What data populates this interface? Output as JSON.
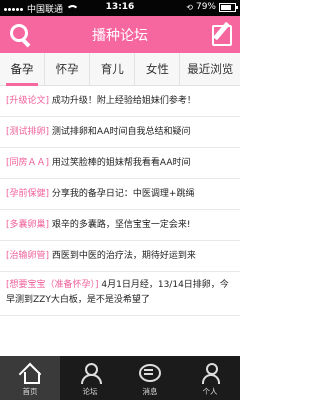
{
  "status": {
    "carrier": "中国联通",
    "time": "13:16",
    "battery": "79%"
  },
  "header": {
    "title": "播种论坛"
  },
  "tabs": [
    {
      "label": "备孕"
    },
    {
      "label": "怀孕"
    },
    {
      "label": "育儿"
    },
    {
      "label": "女性"
    },
    {
      "label": "最近浏览"
    }
  ],
  "posts": [
    {
      "tag": "[升级论文]",
      "text": "成功升级！附上经验给姐妹们参考！"
    },
    {
      "tag": "[测试排卵]",
      "text": "测试排卵和AA时间自我总结和疑问"
    },
    {
      "tag": "[同房ＡＡ]",
      "text": "用过笑脸棒的姐妹帮我看看AA时间"
    },
    {
      "tag": "[孕前保健]",
      "text": "分享我的备孕日记：中医调理+跳绳"
    },
    {
      "tag": "[多囊卵巢]",
      "text": "艰辛的多囊路，坚信宝宝一定会来!"
    },
    {
      "tag": "[治输卵管]",
      "text": "西医到中医的治疗法，期待好运到来"
    },
    {
      "tag": "[想要宝宝（准备怀孕）]",
      "text": "4月1日月经，13/14日排卵，今早测到ZZY大白板，是不是没希望了"
    }
  ],
  "bottom_nav": [
    {
      "label": "首页"
    },
    {
      "label": "论坛"
    },
    {
      "label": "消息"
    },
    {
      "label": "个人"
    }
  ]
}
